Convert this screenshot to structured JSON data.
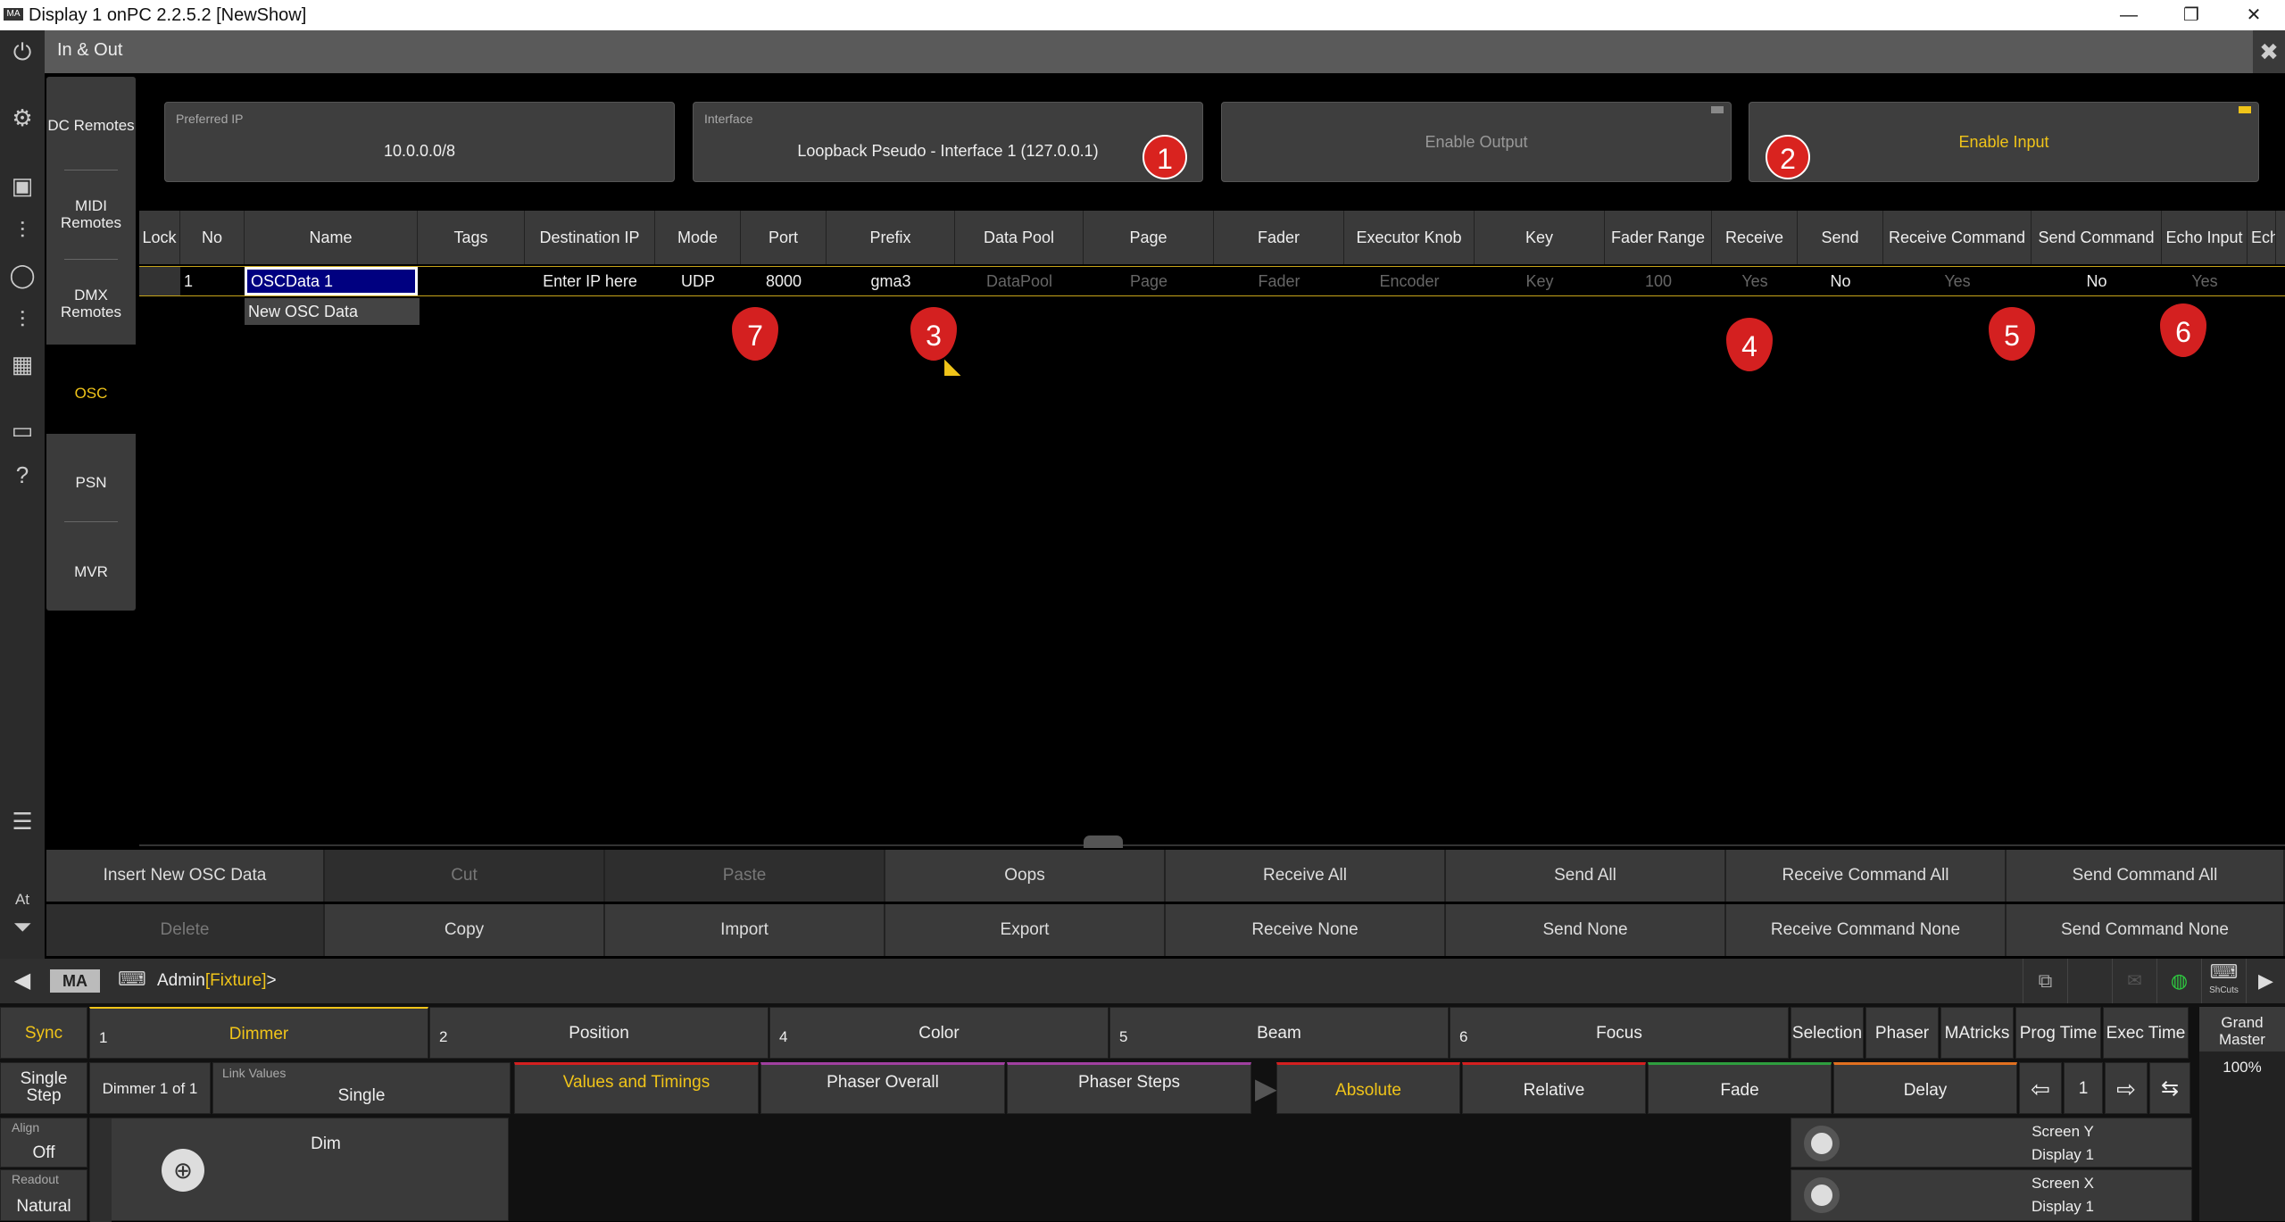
{
  "window": {
    "title": "Display 1 onPC 2.2.5.2 [NewShow]",
    "logo": "MA",
    "minimize": "—",
    "maximize": "❐",
    "close": "✕"
  },
  "header": {
    "title": "In & Out"
  },
  "side_nav": [
    "DC Remotes",
    "MIDI Remotes",
    "DMX Remotes",
    "OSC",
    "PSN",
    "MVR"
  ],
  "panels": {
    "preferred_ip": {
      "label": "Preferred IP",
      "value": "10.0.0.0/8"
    },
    "interface": {
      "label": "Interface",
      "value": "Loopback Pseudo - Interface 1 (127.0.0.1)"
    },
    "enable_output": "Enable Output",
    "enable_input": "Enable Input"
  },
  "table": {
    "columns": [
      "Lock",
      "No",
      "Name",
      "Tags",
      "Destination IP",
      "Mode",
      "Port",
      "Prefix",
      "Data Pool",
      "Page",
      "Fader",
      "Executor Knob",
      "Key",
      "Fader Range",
      "Receive",
      "Send",
      "Receive Command",
      "Send Command",
      "Echo Input",
      "Ech"
    ],
    "row": [
      "",
      "1",
      "OSCData 1",
      "",
      "Enter IP here",
      "UDP",
      "8000",
      "gma3",
      "DataPool",
      "Page",
      "Fader",
      "Encoder",
      "Key",
      "100",
      "Yes",
      "No",
      "Yes",
      "No",
      "Yes",
      ""
    ],
    "dropdown_item": "New OSC Data"
  },
  "annotations": [
    "1",
    "2",
    "3",
    "4",
    "5",
    "6",
    "7"
  ],
  "actions": {
    "row1": [
      "Insert New OSC Data",
      "Cut",
      "Paste",
      "Oops",
      "Receive All",
      "Send All",
      "Receive Command All",
      "Send Command All"
    ],
    "row2": [
      "Delete",
      "Copy",
      "Import",
      "Export",
      "Receive None",
      "Send None",
      "Receive Command None",
      "Send Command None"
    ]
  },
  "cmdline": {
    "logo": "MA",
    "prompt": "Admin",
    "object": "[Fixture]",
    "suffix": ">",
    "shortcuts": "ShCuts"
  },
  "side_left_icons": {
    "at": "At"
  },
  "presets": {
    "sync": "Sync",
    "items": [
      {
        "num": "1",
        "label": "Dimmer"
      },
      {
        "num": "2",
        "label": "Position"
      },
      {
        "num": "4",
        "label": "Color"
      },
      {
        "num": "5",
        "label": "Beam"
      },
      {
        "num": "6",
        "label": "Focus"
      }
    ],
    "right": [
      "Selection",
      "Phaser",
      "MAtricks",
      "Prog Time",
      "Exec Time"
    ],
    "grand_master": {
      "label": "Grand Master",
      "value": "100%"
    }
  },
  "row2": {
    "single_step": "Single Step",
    "dimmer_of": "Dimmer 1 of 1",
    "link_values": {
      "label": "Link Values",
      "value": "Single"
    },
    "values_timings": "Values and Timings",
    "phaser_overall": "Phaser Overall",
    "phaser_steps": "Phaser Steps",
    "absolute": "Absolute",
    "relative": "Relative",
    "fade": "Fade",
    "delay": "Delay",
    "page": "1"
  },
  "row3": {
    "align": {
      "label": "Align",
      "value": "Off"
    },
    "readout": {
      "label": "Readout",
      "value": "Natural"
    },
    "dim": "Dim",
    "screen_y": {
      "name": "Screen Y",
      "display": "Display 1"
    },
    "screen_x": {
      "name": "Screen X",
      "display": "Display 1"
    }
  },
  "colors": {
    "accent": "#f0c419",
    "annotation": "#d9231f"
  }
}
